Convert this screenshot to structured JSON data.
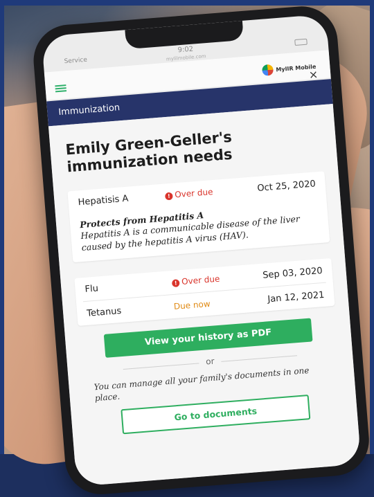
{
  "statusbar": {
    "carrier": "Service",
    "time": "9:02",
    "url": "mylilmobile.com"
  },
  "brand": {
    "logo_label": "MyIIR Mobile"
  },
  "header": {
    "title": "Immunization",
    "close_label": "×"
  },
  "main": {
    "title": "Emily Green-Geller's immunization needs",
    "hepatitis": {
      "name": "Hepatisis A",
      "status": "Over due",
      "date": "Oct 25, 2020",
      "desc_title": "Protects from Hepatitis A",
      "desc_body": "Hepatitis A is a communicable disease of the liver caused by the hepatitis A virus (HAV)."
    },
    "flu": {
      "name": "Flu",
      "status": "Over due",
      "date": "Sep 03, 2020"
    },
    "tetanus": {
      "name": "Tetanus",
      "status": "Due now",
      "date": "Jan 12, 2021"
    },
    "pdf_button": "View your history as PDF",
    "or_label": "or",
    "manage_text": "You can manage all your family's documents in one place.",
    "docs_button": "Go to documents"
  },
  "colors": {
    "navy": "#27346a",
    "green": "#2eae5f",
    "overdue": "#d9342b",
    "duenow": "#e08a14"
  },
  "icons": {
    "menu": "hamburger-icon",
    "close": "close-icon",
    "alert": "alert-icon",
    "logo": "logo-icon"
  }
}
